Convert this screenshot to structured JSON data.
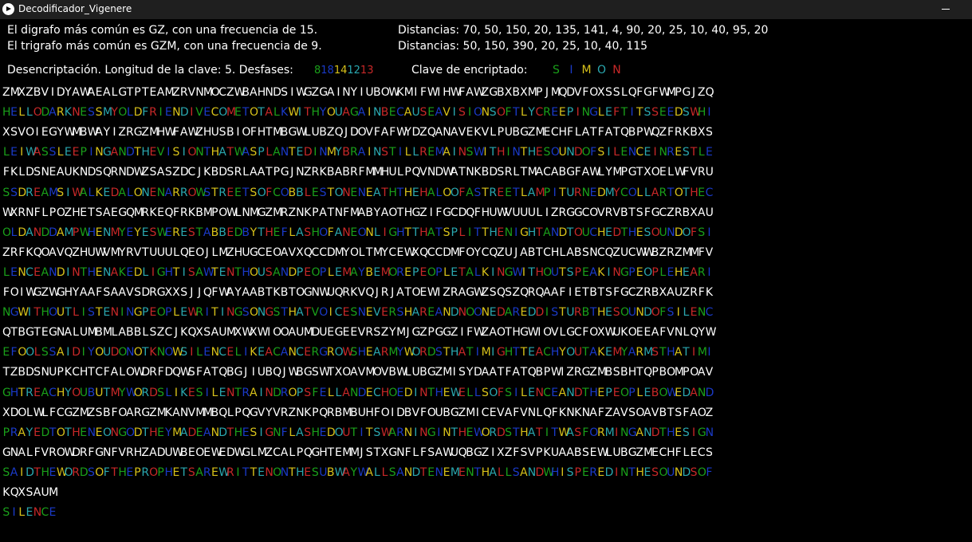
{
  "window": {
    "title": "Decodificador_Vigenere"
  },
  "stats": {
    "digraph": "El digrafo más común es GZ, con una frecuencia de 15.",
    "trigraph": "El trigrafo más común es GZM, con una frecuencia de 9.",
    "digraph_distances": "Distancias: 70, 50, 150, 20, 135, 141, 4, 90, 20, 25, 10, 40, 95, 20",
    "trigraph_distances": "Distancias: 50, 150, 390, 20, 25, 10, 40, 115",
    "decryption": "Desencriptación. Longitud de la clave: 5. Desfases:",
    "offsets": [
      "8",
      "18",
      "14",
      "12",
      "13"
    ],
    "key_label": "Clave de encriptado:",
    "key_letters": [
      "S",
      "I",
      "M",
      "O",
      "N"
    ]
  },
  "colors": {
    "background": "#000000",
    "text": "#ffffff",
    "titlebar": "#1f1f1f",
    "offset_palette": [
      "#1aa01a",
      "#1a3ac8",
      "#d8c21a",
      "#2aa8b0",
      "#c82828"
    ],
    "key_palette": [
      "#1aa01a",
      "#1a3ac8",
      "#d8c21a",
      "#2aa8b0",
      "#c82828"
    ],
    "plain_palette": [
      "#1aa01a",
      "#1a3ac8",
      "#d8c21a",
      "#2aa8b0",
      "#c82828"
    ]
  },
  "icons": {
    "app": "play-circle-icon",
    "minimize": "minimize-icon"
  },
  "cipher_lines": [
    "ZMXZBVIDYAWAEALGTPTEAMZRVNMOCZWBAHNDSIWGZGAINYIUBOWKMIFWIHWFAWZGBXBXMPJMQDVFOXSSLQFGFWMPGJZQ",
    "XSVOIEGYWMBWAYIZRGZMHWFAWZHUSBIOFHTMBGWLUBZQJDOVFAFWYDZQANAVEKVLPUBGZMECHFLATFATQBPWQZFRKBXS",
    "FKLDSNEAUKNDSQRNDWZSASZDCJKBDSRLAATPGJNZRKBABRFMMHULPQVNDWATNKBDSRLTMACABGFAWLYMPGTXOELWFVRU",
    "WXRNFLPOZHETSAEGQMRKEQFRKBMPOWLNMGZMRZNKPATNFMABYAOTHGZIFGCDQFHUWVUUULIZRGGCOVRVBTSFGCZRBXAU",
    "ZRFKQOAVQZHUWVMYRVTUUULQEOJLMZHUGCEOAVXQCCDMYOLTMYCEWXQCCDMFOYCQZUJABTCHLABSNCQZUCWWBZRZMMFV",
    "FOIWGZWGHYAAFSAAVSDRGXXSJJQFWAYAABTKBTOGNWUQRKVQJRJATOEWIZRAGWZSQSZQRQAAFIETBTSFGCZRBXAUZRFK",
    "QTBGTEGNALUMBMLABBLSZCJKQXSAUMXWXWIOOAUMDUEGEEVRSZYMJGZPGGZIFWZAOTHGWIOVLGCFOXWUKOEEAFVNLQYW",
    "TZBDSNUPKCHTCFALOWDRFDQWSFATQBGJIUBQJWBGSWTXOAVMOVBWLUBGZMISYDAATFATQBPWIZRGZMBSBHTQPBOMPOAV",
    "XDOLWLFCGZMZSBFOARGZMKANVMMBQLPQGVYVRZNKPQRBMBUHFOIDBVFOUBGZMICEVAFVNLQFKNKNAFZAVSOAVBTSFAOZ",
    "GNALFVROWDRFGNFVRHZADUWBEOEWEDWGLMZCALPQGHTEMMJSTXGNFLFSAWUQBGZIXZFSVPKUAABSEWLUBGZMECHFLECS",
    "KQXSAUM"
  ],
  "plain_lines": [
    "HELLODARKNESSMYOLDFRIENDIVECOMETOTALKWITHYOUAGAINBECAUSEAVISIONSOFTLYCREEPINGLEFTITSSEEDSWHI",
    "LEIWASSLEEPINGANDTHEVISIONTHATWASPLANTEDINMYBRAINSTILLREMAINSWITHINTHESOUNDOFSILENCEINRESTLE",
    "SSDREAMSIWALKEDALONENARROWSTREETSOFCOBBLESTONENEATHTHEHALOOFASTREETLAMPITURNEDMYCOLLARTOTHEC",
    "OLDANDDAMPWHENMYEYESWERESTABBEDBYTHEFLASHOFANEONLIGHTTHATSPLITTHENIGHTANDTOUCHEDTHESOUNDOFSI",
    "LENCEANDINTHENAKEDLIGHTISAWTENTHOUSANDPEOPLEMAYBEMOREPEOPLETALKINGWITHOUTSPEAKINGPEOPLEHEARI",
    "NGWITHOUTLISTENINGPEOPLEWRITINGSONGSTHATVOICESNEVERSHAREANDNOONEDAREDDISTURBTHESOUNDOFSILENC",
    "EFOOLSSAIDIYOUDONOTKNOWSILENCELIKEACANCERGROWSHEARMYWORDSTHATIMIGHTTEACHYOUTAKEMYARMSTHATIMI",
    "GHTREACHYOUBUTMYWORDSLIKESILENTRAINDROPSFELLANDECHOEDINTHEWELLSOFSILENCEANDTHEPEOPLEBOWEDAND",
    "PRAYEDTOTHENEONGODTHEYMADEANDTHESIGNFLASHEDOUTITSWARNINGINTHEWORDSTHATITWASFORMINGANDTHESIGN",
    "SAIDTHEWORDSOFTHEPROPHETSAREWRITTENONTHESUBWAYWALLSANDTENEMENTHALLSANDWHISPEREDINTHESOUNDSOF",
    "SILENCE"
  ]
}
